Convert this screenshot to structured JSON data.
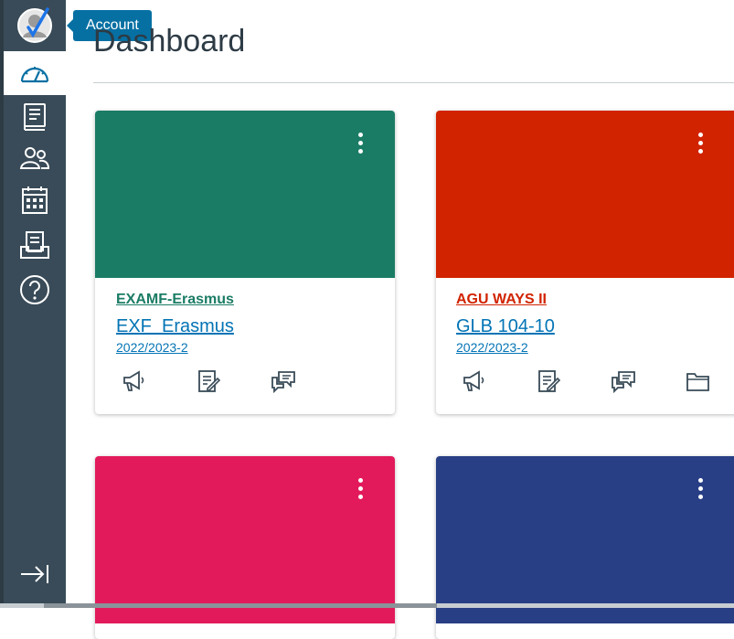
{
  "nav": {
    "tooltip": "Account",
    "items": [
      {
        "name": "dashboard-icon"
      },
      {
        "name": "courses-icon"
      },
      {
        "name": "groups-icon"
      },
      {
        "name": "calendar-icon"
      },
      {
        "name": "inbox-icon"
      },
      {
        "name": "help-icon"
      }
    ],
    "collapse": "collapse-nav-icon"
  },
  "page": {
    "title": "Dashboard"
  },
  "cards": [
    {
      "color": "#1b7c65",
      "code": "EXAMF-Erasmus",
      "name": "EXF  Erasmus",
      "term": "2022/2023-2",
      "actions": [
        "announcements-icon",
        "assignments-icon",
        "discussions-icon"
      ]
    },
    {
      "color": "#d12300",
      "code": "AGU WAYS II",
      "name": "GLB 104-10",
      "term": "2022/2023-2",
      "actions": [
        "announcements-icon",
        "assignments-icon",
        "discussions-icon",
        "files-icon"
      ]
    },
    {
      "color": "#e21a5b",
      "code": "",
      "name": "",
      "term": ""
    },
    {
      "color": "#283e85",
      "code": "",
      "name": "",
      "term": ""
    }
  ]
}
